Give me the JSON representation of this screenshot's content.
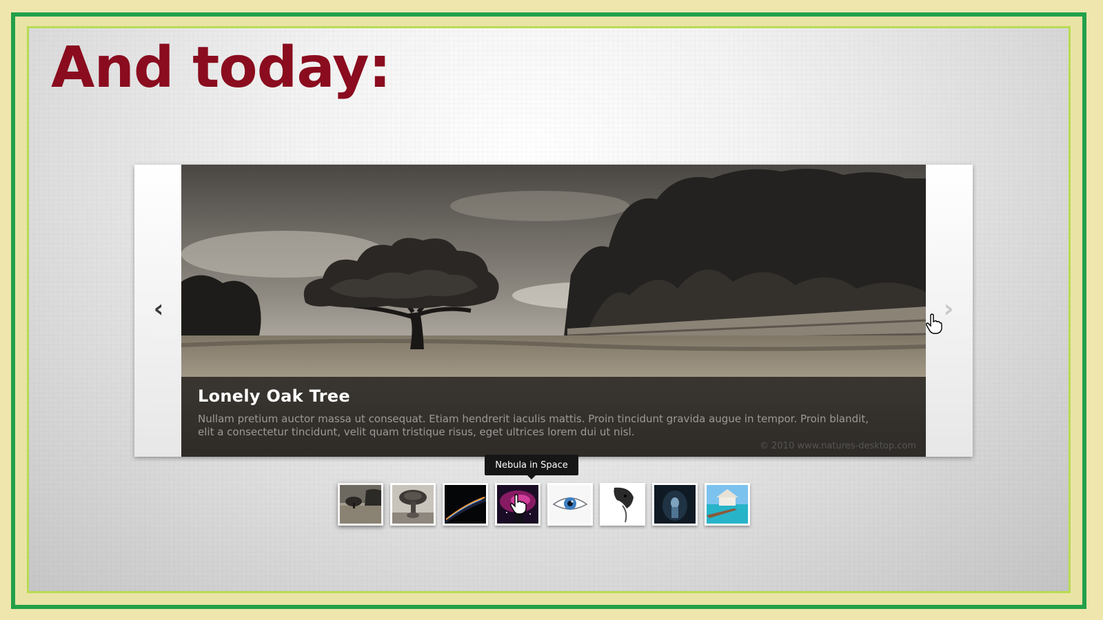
{
  "slide": {
    "title": "And today:"
  },
  "gallery": {
    "current": {
      "title": "Lonely Oak Tree",
      "description": "Nullam pretium auctor massa ut consequat. Etiam hendrerit iaculis mattis. Proin tincidunt gravida augue in tempor. Proin blandit, elit a consectetur tincidunt, velit quam tristique risus, eget ultrices lorem dui ut nisl.",
      "credit": "© 2010 www.natures-desktop.com"
    },
    "prev_icon": "chevron-left-icon",
    "next_icon": "chevron-right-icon",
    "prev_glyph": "‹",
    "next_glyph": "›",
    "tooltip": "Nebula in Space",
    "thumbnails": [
      {
        "name": "thumb-oak-tree",
        "active": true
      },
      {
        "name": "thumb-mushroom-cloud",
        "active": false
      },
      {
        "name": "thumb-planet-horizon",
        "active": false
      },
      {
        "name": "thumb-nebula",
        "active": false
      },
      {
        "name": "thumb-eye",
        "active": false
      },
      {
        "name": "thumb-face-sketch",
        "active": false
      },
      {
        "name": "thumb-dark-figure",
        "active": false
      },
      {
        "name": "thumb-beach-hut",
        "active": false
      }
    ]
  },
  "colors": {
    "title": "#8a0c1e",
    "outer_border": "#22a04a",
    "inner_border": "#b8dc52",
    "frame_background": "#efe6ad"
  }
}
